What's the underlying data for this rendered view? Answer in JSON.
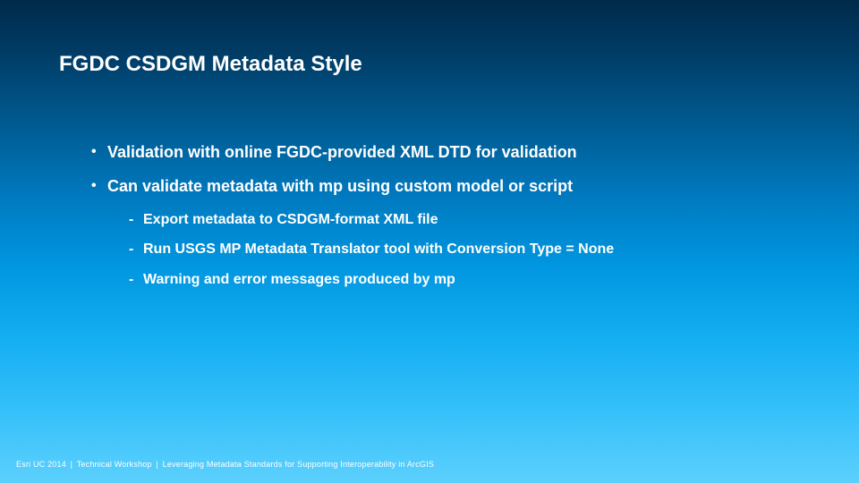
{
  "slide": {
    "title": "FGDC CSDGM Metadata Style",
    "bullets": [
      {
        "text": "Validation with online FGDC-provided XML DTD for validation",
        "sub": []
      },
      {
        "text": "Can validate metadata with mp using custom model or script",
        "sub": [
          "Export metadata to CSDGM-format XML file",
          "Run USGS MP Metadata Translator tool with Conversion Type = None",
          "Warning and error messages produced by mp"
        ]
      }
    ]
  },
  "footer": {
    "event": "Esri UC 2014",
    "track": "Technical Workshop",
    "session": "Leveraging Metadata Standards for Supporting Interoperability in ArcGIS",
    "sep": "|"
  }
}
